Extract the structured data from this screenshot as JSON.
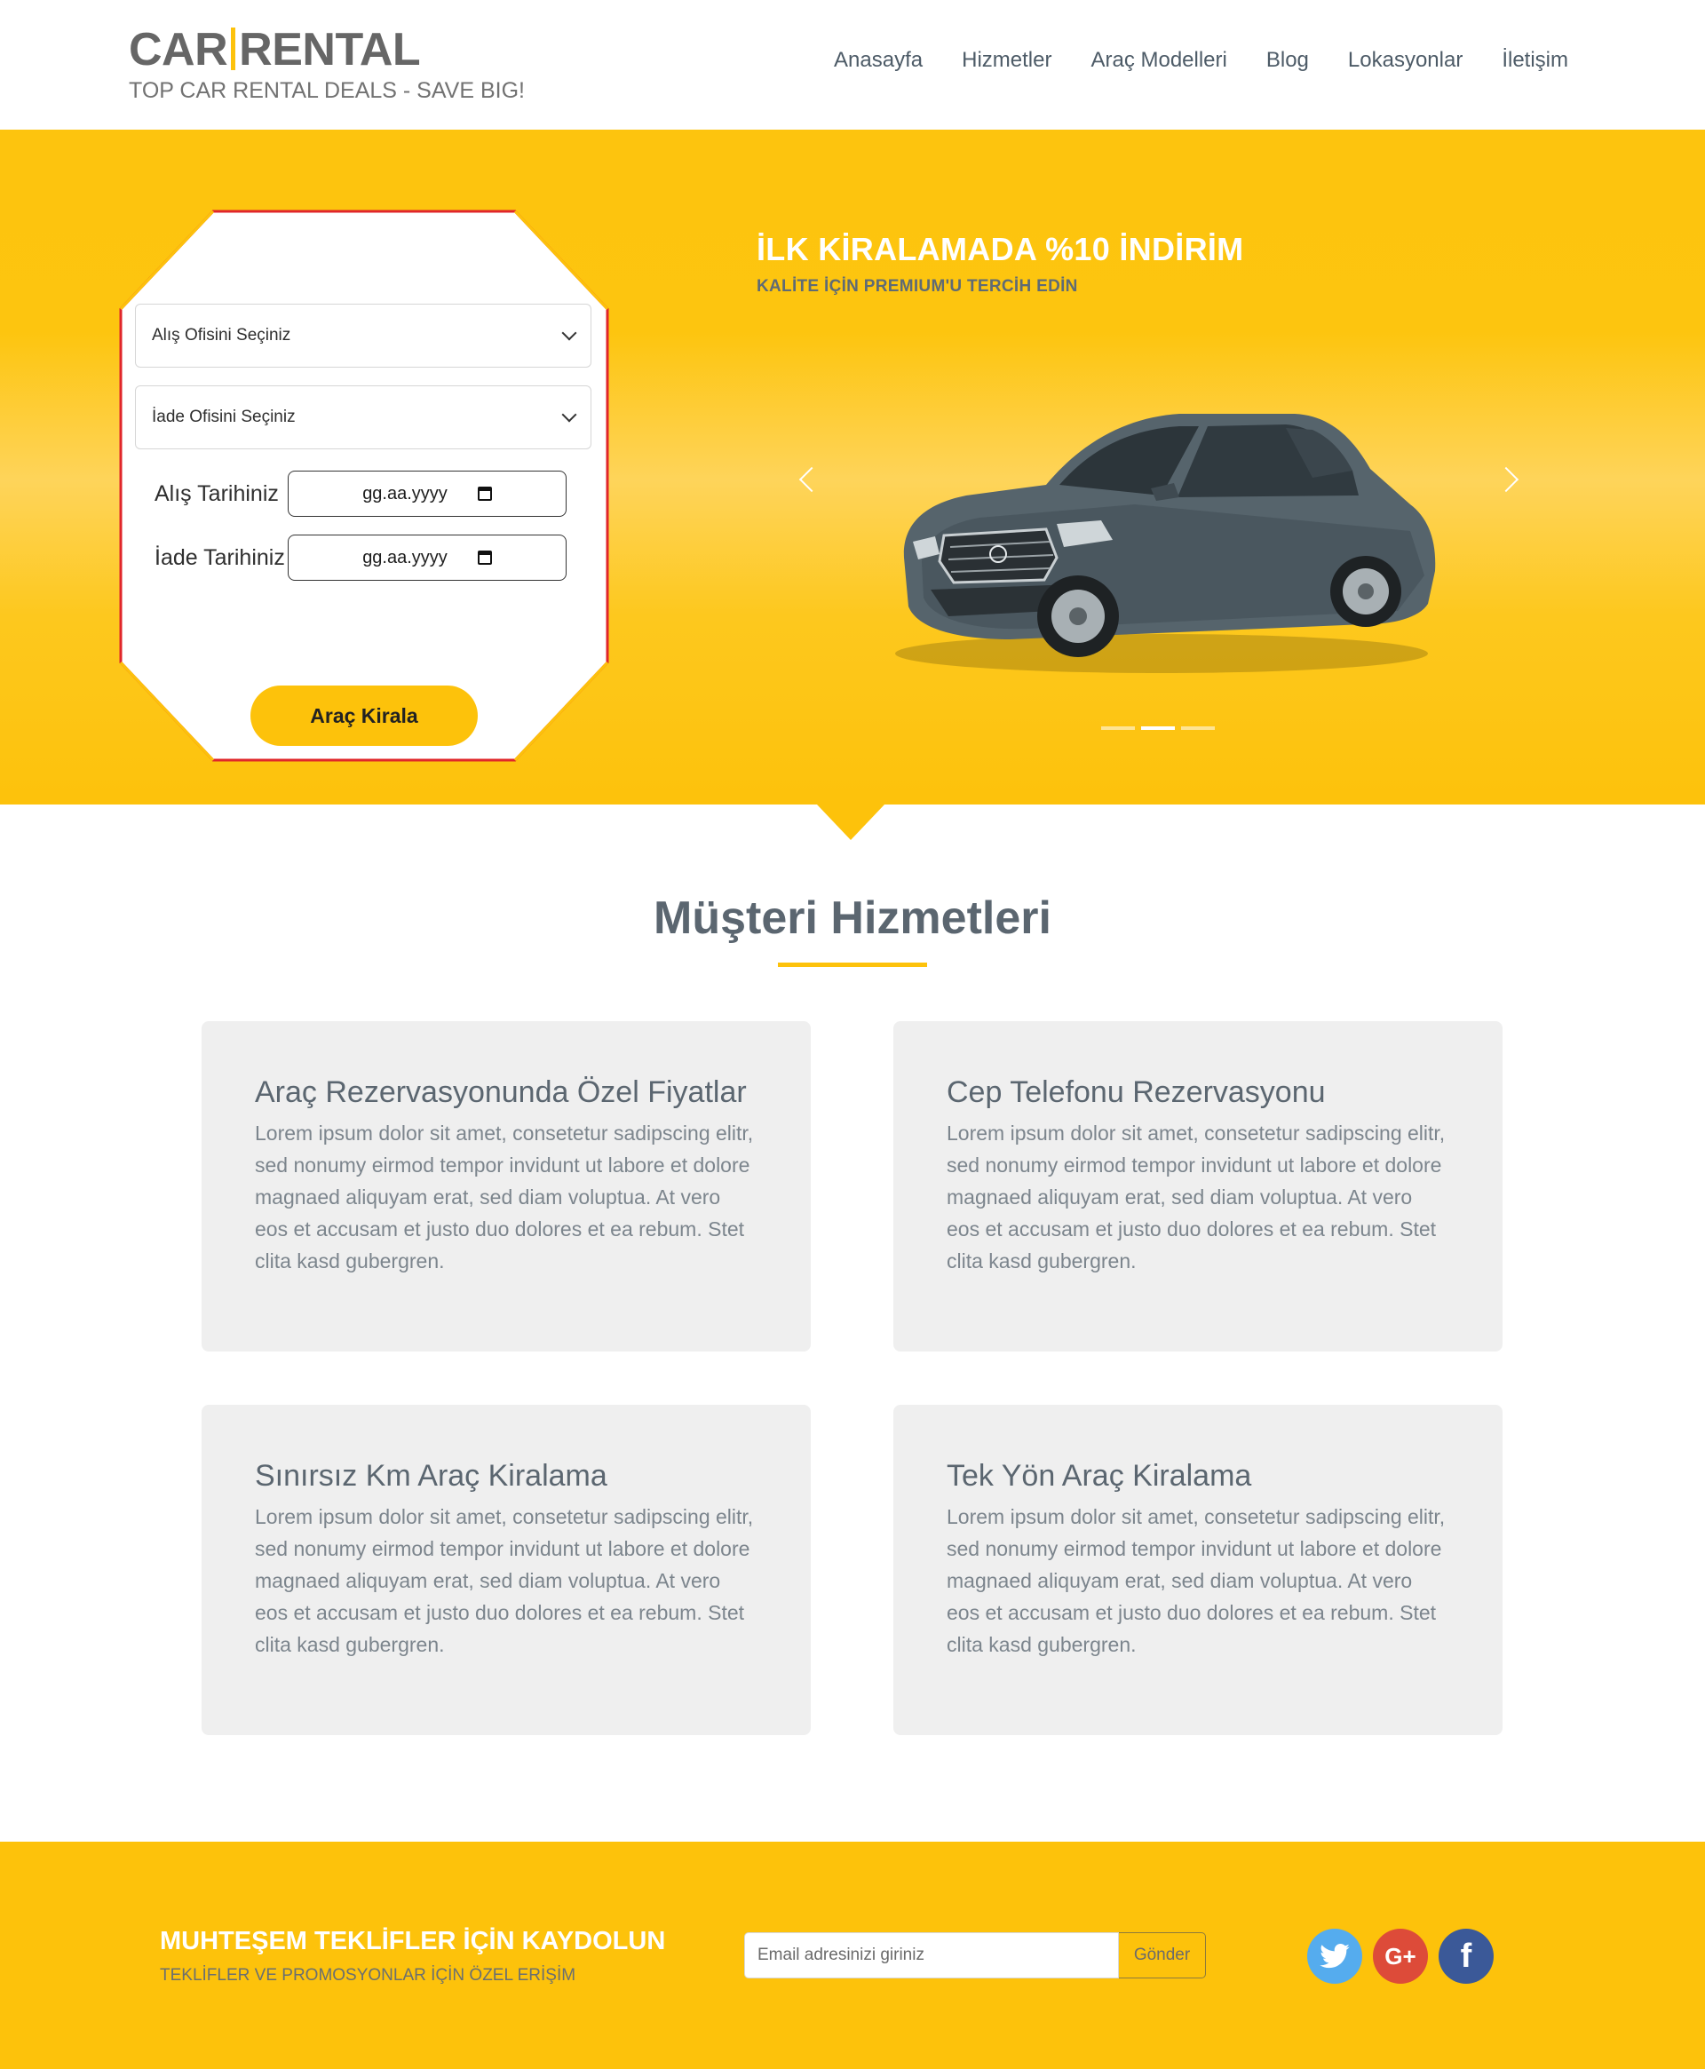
{
  "header": {
    "logo_left": "CAR",
    "logo_right": "RENTAL",
    "tagline": "TOP CAR RENTAL DEALS - SAVE BIG!",
    "nav": [
      "Anasayfa",
      "Hizmetler",
      "Araç Modelleri",
      "Blog",
      "Lokasyonlar",
      "İletişim"
    ]
  },
  "hero": {
    "form": {
      "pickup_office": "Alış Ofisini Seçiniz",
      "return_office": "İade Ofisini Seçiniz",
      "pickup_date_label": "Alış Tarihiniz",
      "return_date_label": "İade Tarihiniz",
      "date_placeholder": "gg.aa.yyyy",
      "submit_label": "Araç Kirala"
    },
    "promo_title": "İLK KİRALAMADA %10 İNDİRİM",
    "promo_subtitle": "KALİTE İÇİN PREMIUM'U TERCİH EDİN",
    "carousel": {
      "slide_count": 3,
      "active_slide": 2
    }
  },
  "services": {
    "title": "Müşteri Hizmetleri",
    "cards": [
      {
        "title": "Araç Rezervasyonunda Özel Fiyatlar",
        "text": "Lorem ipsum dolor sit amet, consetetur sadipscing elitr, sed nonumy eirmod tempor invidunt ut labore et dolore magnaed aliquyam erat, sed diam voluptua. At vero eos et accusam et justo duo dolores et ea rebum. Stet clita kasd gubergren."
      },
      {
        "title": "Cep Telefonu Rezervasyonu",
        "text": "Lorem ipsum dolor sit amet, consetetur sadipscing elitr, sed nonumy eirmod tempor invidunt ut labore et dolore magnaed aliquyam erat, sed diam voluptua. At vero eos et accusam et justo duo dolores et ea rebum. Stet clita kasd gubergren."
      },
      {
        "title": "Sınırsız Km Araç Kiralama",
        "text": "Lorem ipsum dolor sit amet, consetetur sadipscing elitr, sed nonumy eirmod tempor invidunt ut labore et dolore magnaed aliquyam erat, sed diam voluptua. At vero eos et accusam et justo duo dolores et ea rebum. Stet clita kasd gubergren."
      },
      {
        "title": "Tek Yön Araç Kiralama",
        "text": "Lorem ipsum dolor sit amet, consetetur sadipscing elitr, sed nonumy eirmod tempor invidunt ut labore et dolore magnaed aliquyam erat, sed diam voluptua. At vero eos et accusam et justo duo dolores et ea rebum. Stet clita kasd gubergren."
      }
    ]
  },
  "footer": {
    "title": "MUHTEŞEM TEKLİFLER İÇİN KAYDOLUN",
    "subtitle": "TEKLİFLER VE PROMOSYONLAR İÇİN ÖZEL ERİŞİM",
    "email_placeholder": "Email adresinizi giriniz",
    "send_label": "Gönder",
    "socials": [
      {
        "icon": "twitter-icon",
        "glyph": "t",
        "color": "#55acee"
      },
      {
        "icon": "google-plus-icon",
        "glyph": "G+",
        "color": "#dd4b39"
      },
      {
        "icon": "facebook-icon",
        "glyph": "f",
        "color": "#3b5998"
      }
    ]
  },
  "colors": {
    "accent": "#fdc20b",
    "text": "#5b6670",
    "form_border": "#e0262a"
  }
}
